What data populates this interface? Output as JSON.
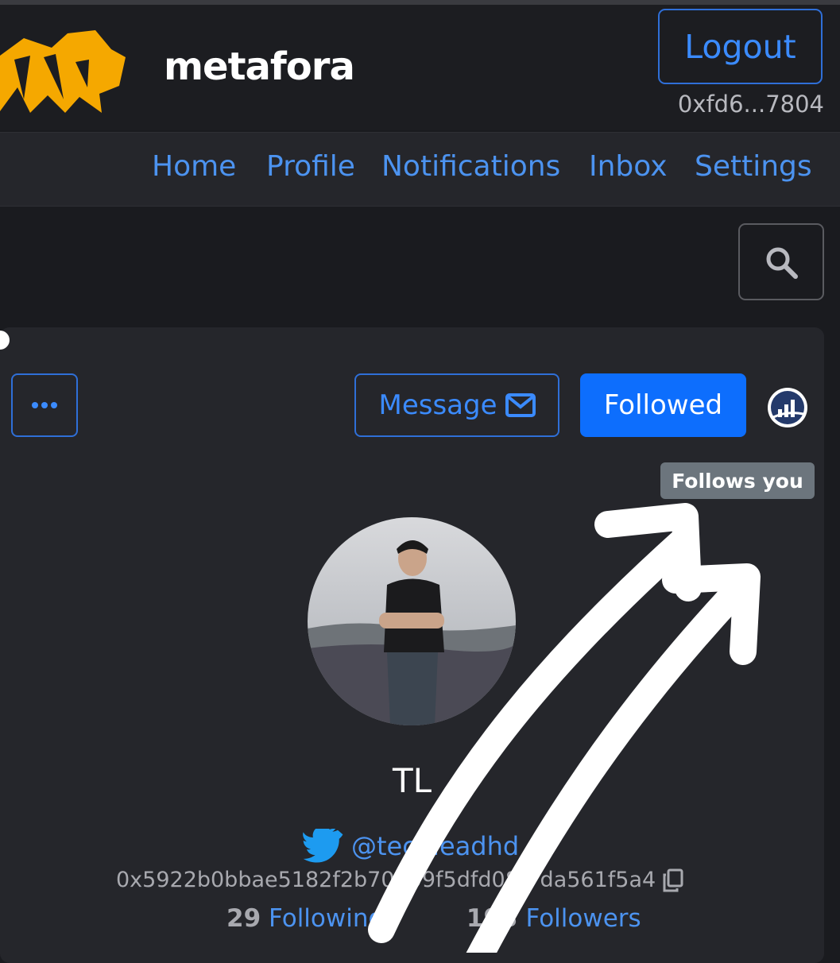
{
  "header": {
    "brand": "metafora",
    "logout_label": "Logout",
    "wallet_short": "0xfd6...7804"
  },
  "nav": {
    "items": [
      {
        "label": "Home"
      },
      {
        "label": "Profile"
      },
      {
        "label": "Notifications"
      },
      {
        "label": "Inbox"
      },
      {
        "label": "Settings"
      }
    ]
  },
  "toolbar": {
    "search_icon": "search-icon"
  },
  "profile": {
    "message_label": "Message",
    "followed_label": "Followed",
    "follows_you_label": "Follows you",
    "name": "TL",
    "twitter_handle": "@techleadhd",
    "address": "0x5922b0bbae5182f2b70609f5dfd08f7da561f5a4",
    "following_count": "29",
    "following_label": "Following",
    "followers_count": "193",
    "followers_label": "Followers"
  },
  "colors": {
    "accent": "#0d6efd",
    "link": "#4c93f0",
    "logo": "#f5a800",
    "badge": "#6c757d",
    "background": "#1a1b1f"
  }
}
